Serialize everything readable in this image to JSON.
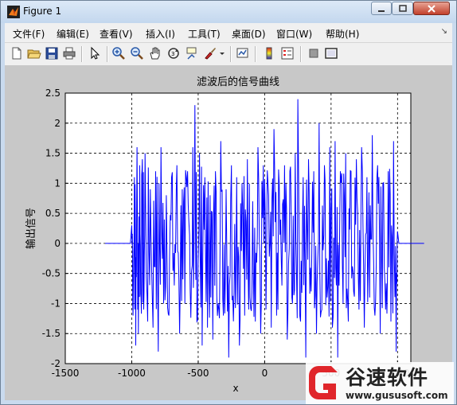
{
  "window": {
    "title": "Figure 1"
  },
  "menu": {
    "items": [
      "文件(F)",
      "编辑(E)",
      "查看(V)",
      "插入(I)",
      "工具(T)",
      "桌面(D)",
      "窗口(W)",
      "帮助(H)"
    ]
  },
  "toolbar": {
    "buttons": [
      "new-figure-icon",
      "open-file-icon",
      "save-icon",
      "print-icon",
      "pointer-icon",
      "zoom-in-icon",
      "zoom-out-icon",
      "pan-hand-icon",
      "rotate-3d-icon",
      "data-cursor-icon",
      "brush-icon",
      "link-plot-icon",
      "colorbar-icon",
      "legend-icon",
      "hide-plot-tools-icon",
      "show-plot-tools-icon"
    ]
  },
  "chart_data": {
    "type": "line",
    "title": "滤波后的信号曲线",
    "xlabel": "x",
    "ylabel": "输出信号",
    "xlim": [
      -1500,
      1100
    ],
    "ylim": [
      -2,
      2.5
    ],
    "xticks": [
      -1500,
      -1000,
      -500,
      0,
      500,
      1000
    ],
    "yticks": [
      -2,
      -1.5,
      -1,
      -0.5,
      0,
      0.5,
      1,
      1.5,
      2,
      2.5
    ],
    "grid": "dashed",
    "line_color": "#0000ff",
    "series": [
      {
        "x": [
          -1200,
          -1010,
          -1000,
          -990,
          -980,
          -970,
          -960,
          -950,
          -940,
          -930,
          -920,
          -910,
          -900,
          -880,
          -860,
          -840,
          -820,
          -800,
          -780,
          -760,
          -740,
          -720,
          -700,
          -680,
          -660,
          -640,
          -620,
          -600,
          -580,
          -560,
          -540,
          -525,
          -510,
          -490,
          -470,
          -450,
          -430,
          -410,
          -390,
          -370,
          -350,
          -330,
          -310,
          -290,
          -270,
          -250,
          -230,
          -210,
          -190,
          -170,
          -150,
          -130,
          -110,
          -90,
          -70,
          -50,
          -30,
          -10,
          10,
          30,
          50,
          70,
          90,
          110,
          130,
          150,
          170,
          190,
          210,
          230,
          250,
          270,
          290,
          310,
          330,
          350,
          370,
          390,
          410,
          430,
          450,
          470,
          490,
          510,
          530,
          550,
          570,
          590,
          610,
          630,
          650,
          670,
          690,
          710,
          730,
          750,
          770,
          790,
          810,
          830,
          850,
          870,
          890,
          910,
          930,
          950,
          970,
          990,
          1000,
          1010,
          1200
        ],
        "y": [
          0,
          0,
          0.3,
          -1.2,
          1.1,
          -1.7,
          1.6,
          -1.5,
          1.3,
          -0.9,
          1.4,
          -1.1,
          1.5,
          -1.3,
          0.9,
          -1.4,
          1.2,
          -1.8,
          1.6,
          -1.0,
          0.8,
          -1.2,
          1.1,
          -0.7,
          1.3,
          -1.5,
          0.9,
          -1.0,
          1.2,
          -0.8,
          1.6,
          2.3,
          -1.3,
          1.5,
          -1.7,
          1.1,
          -1.4,
          0.8,
          -1.6,
          1.2,
          -1.0,
          1.7,
          -1.2,
          0.9,
          -1.9,
          1.3,
          -0.8,
          1.1,
          -1.7,
          1.0,
          -1.2,
          1.4,
          -0.9,
          0.7,
          -1.3,
          1.6,
          -1.5,
          1.3,
          -1.1,
          0.8,
          -1.4,
          1.9,
          -1.2,
          1.0,
          -0.7,
          1.3,
          -1.6,
          1.2,
          -1.0,
          1.5,
          2.4,
          -1.3,
          1.1,
          -1.9,
          1.4,
          -0.8,
          1.2,
          -1.5,
          2.0,
          -1.1,
          1.3,
          -0.9,
          1.6,
          -1.4,
          1.7,
          -1.9,
          1.2,
          -1.0,
          1.5,
          -1.3,
          1.2,
          -0.8,
          1.4,
          -1.1,
          1.6,
          -1.4,
          1.1,
          -0.9,
          1.8,
          -1.2,
          1.3,
          -1.5,
          1.0,
          -1.1,
          1.2,
          -1.3,
          1.7,
          -1.8,
          0.2,
          0,
          0
        ]
      }
    ]
  }
}
